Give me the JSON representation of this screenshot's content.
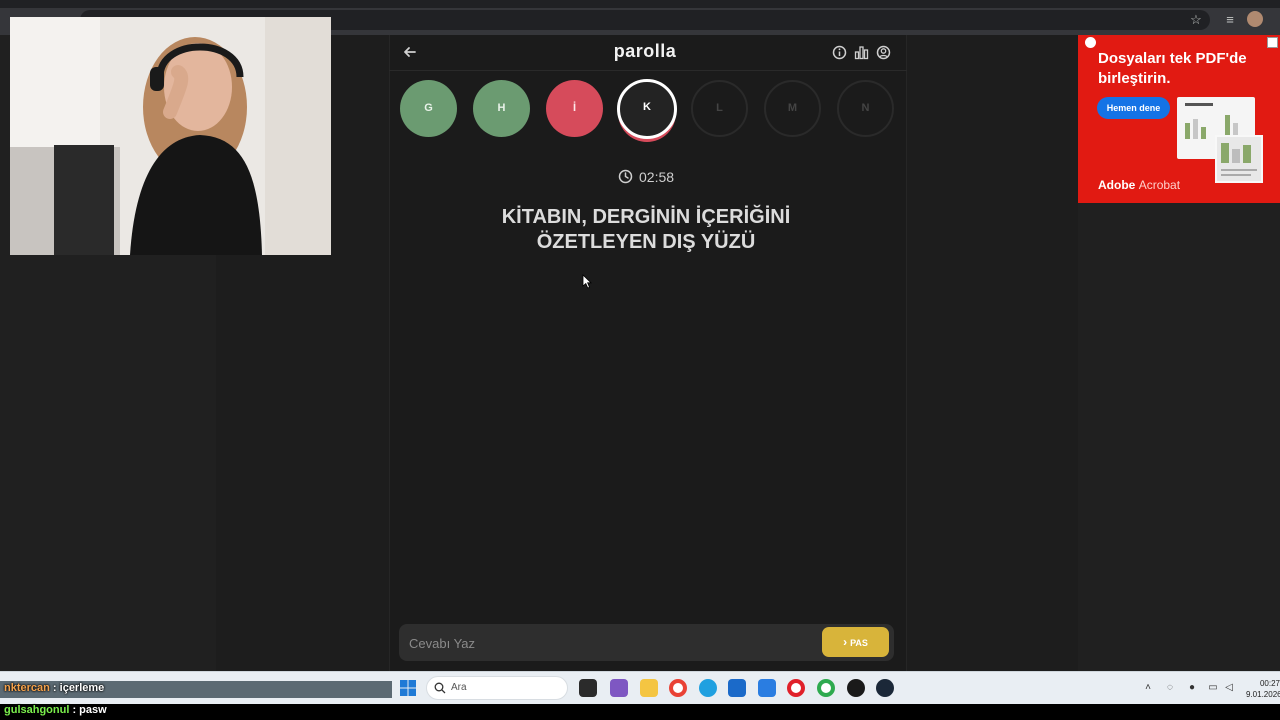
{
  "game": {
    "logo": "parolla",
    "letters": [
      {
        "letter": "G",
        "status": "correct"
      },
      {
        "letter": "H",
        "status": "correct"
      },
      {
        "letter": "İ",
        "status": "wrong"
      },
      {
        "letter": "K",
        "status": "current"
      },
      {
        "letter": "L",
        "status": "pending"
      },
      {
        "letter": "M",
        "status": "pending"
      },
      {
        "letter": "N",
        "status": "pending"
      }
    ],
    "timer": "02:58",
    "question_line1": "KİTABIN, DERGİNİN İÇERİĞİNİ",
    "question_line2": "ÖZETLEYEN DIŞ YÜZÜ",
    "answer_placeholder": "Cevabı Yaz",
    "pass_label": "PAS",
    "colors": {
      "correct": "#6b9b71",
      "wrong": "#d64b5b",
      "pass": "#d8b43a"
    }
  },
  "ad": {
    "title": "Dosyaları tek PDF'de birleştirin.",
    "button": "Hemen dene",
    "brand": "Adobe",
    "product": "Acrobat"
  },
  "chat": {
    "line1_user": "nktercan",
    "line1_text": ": içerleme",
    "line2_user": "gulsahgonul",
    "line2_text": ": pasw"
  },
  "taskbar": {
    "search_placeholder": "Ara",
    "time": "00:27",
    "date": "9.01.2026"
  }
}
